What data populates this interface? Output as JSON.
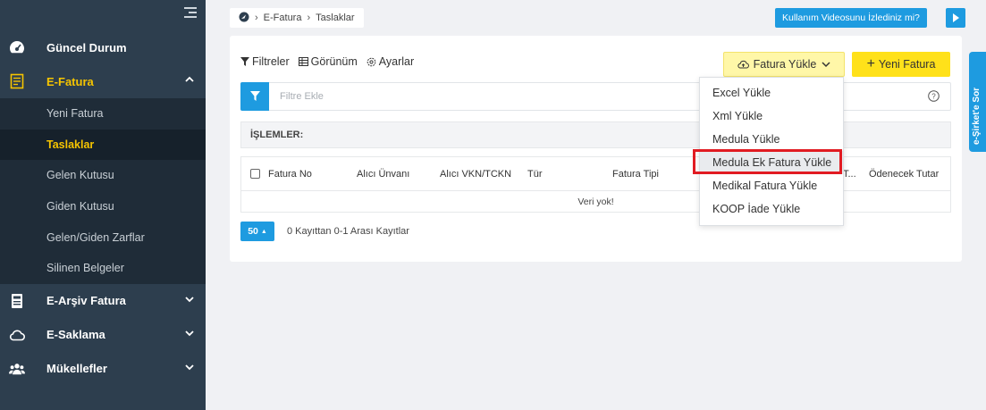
{
  "sidebar": {
    "items": [
      {
        "label": "Güncel Durum"
      },
      {
        "label": "E-Fatura"
      },
      {
        "label": "E-Arşiv Fatura"
      },
      {
        "label": "E-Saklama"
      },
      {
        "label": "Mükellefler"
      }
    ],
    "efatura_sub": [
      "Yeni Fatura",
      "Taslaklar",
      "Gelen Kutusu",
      "Giden Kutusu",
      "Gelen/Giden Zarflar",
      "Silinen Belgeler"
    ]
  },
  "breadcrumb": [
    "E-Fatura",
    "Taslaklar"
  ],
  "header": {
    "video_label": "Kullanım Videosunu İzlediniz mi?",
    "side_tab": "e-Şirket'e Sor"
  },
  "toolbar": {
    "filters": "Filtreler",
    "view": "Görünüm",
    "settings": "Ayarlar",
    "upload": "Fatura Yükle",
    "new_invoice": "Yeni Fatura"
  },
  "filter": {
    "placeholder": "Filtre Ekle"
  },
  "operations_label": "İŞLEMLER:",
  "table": {
    "columns": [
      "Fatura No",
      "Alıcı Ünvanı",
      "Alıcı VKN/TCKN",
      "Tür",
      "Fatura Tipi",
      "T...",
      "Ödenecek Tutar"
    ],
    "empty": "Veri yok!"
  },
  "paging": {
    "size": "50",
    "info": "0 Kayıttan 0-1 Arası Kayıtlar"
  },
  "dropdown": [
    "Excel Yükle",
    "Xml Yükle",
    "Medula Yükle",
    "Medula Ek Fatura Yükle",
    "Medikal Fatura Yükle",
    "KOOP İade Yükle"
  ],
  "colors": {
    "sidebar": "#2d3e4e",
    "accent": "#f5c400",
    "primary": "#1e9be0",
    "highlight": "#e11b22"
  }
}
